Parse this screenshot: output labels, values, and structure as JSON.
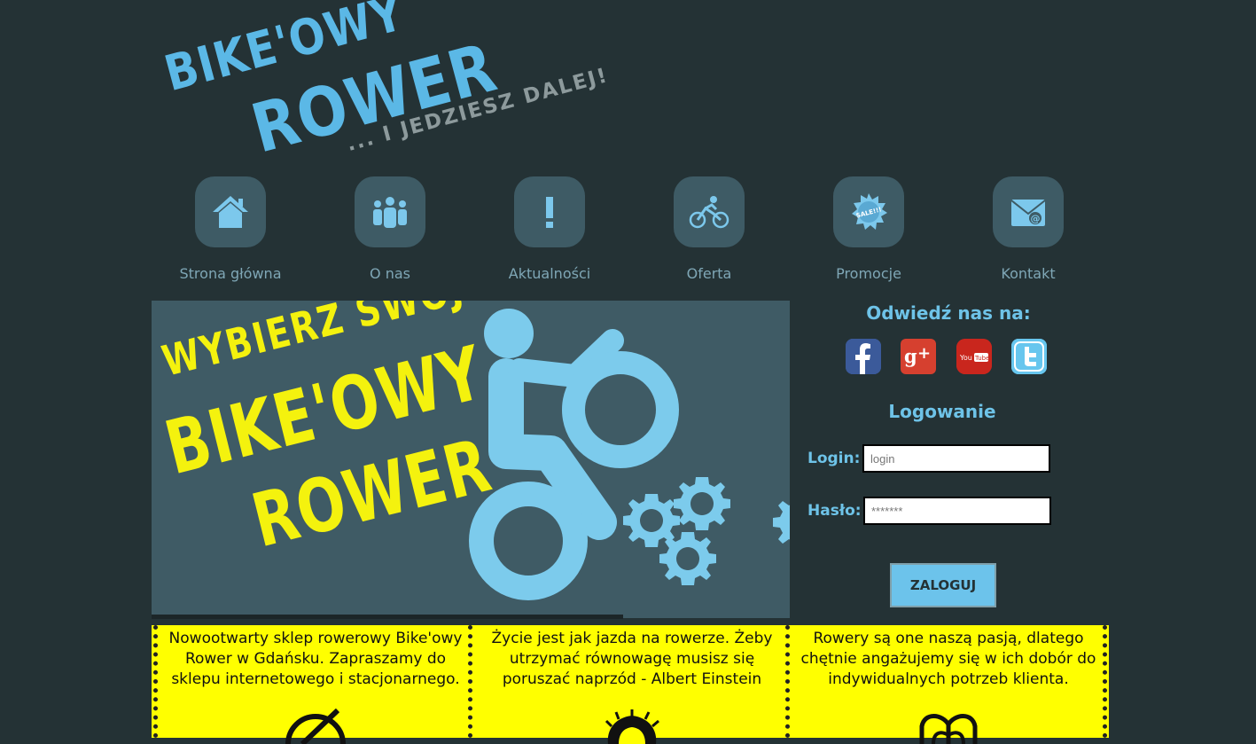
{
  "logo": {
    "line1": "BIKE'OWY",
    "line2": "ROWER",
    "tagline": "... I JEDZIESZ DALEJ!"
  },
  "nav": {
    "items": [
      {
        "label": "Strona główna",
        "icon": "home-icon"
      },
      {
        "label": "O nas",
        "icon": "people-icon"
      },
      {
        "label": "Aktualności",
        "icon": "exclamation-icon"
      },
      {
        "label": "Oferta",
        "icon": "cyclist-icon"
      },
      {
        "label": "Promocje",
        "icon": "sale-badge-icon"
      },
      {
        "label": "Kontakt",
        "icon": "mail-icon"
      }
    ]
  },
  "banner": {
    "line1": "WYBIERZ SWÓJ",
    "line2": "BIKE'OWY",
    "line3": "ROWER"
  },
  "sidebar": {
    "social_title": "Odwiedź nas na:",
    "social": [
      {
        "name": "facebook",
        "icon": "facebook-icon"
      },
      {
        "name": "google-plus",
        "icon": "google-plus-icon"
      },
      {
        "name": "youtube",
        "icon": "youtube-icon"
      },
      {
        "name": "twitter",
        "icon": "twitter-icon"
      }
    ],
    "login_title": "Logowanie",
    "login_label": "Login:",
    "login_placeholder": "login",
    "password_label": "Hasło:",
    "password_placeholder": "*******",
    "submit_label": "ZALOGUJ"
  },
  "boxes": [
    {
      "text": "Nowootwarty sklep rowerowy Bike'owy Rower w Gdańsku. Zapraszamy do sklepu internetowego i stacjonarnego."
    },
    {
      "text": "Życie jest jak jazda na rowerze. Żeby utrzymać równowagę musisz się poruszać naprzód - Albert Einstein"
    },
    {
      "text": "Rowery są one naszą pasją, dlatego chętnie angażujemy się w ich dobór do indywidualnych potrzeb klienta."
    }
  ],
  "colors": {
    "background": "#243235",
    "accent_blue": "#6ec3e8",
    "banner_bg": "#3f5b65",
    "banner_yellow": "#f4f20e",
    "box_yellow": "#ffff00"
  }
}
